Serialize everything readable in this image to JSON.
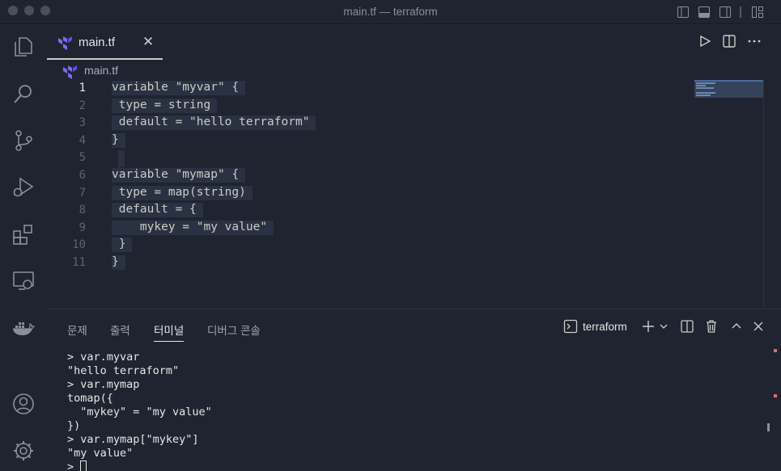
{
  "window": {
    "title": "main.tf — terraform"
  },
  "activity_bar": {
    "items": [
      "explorer-icon",
      "search-icon",
      "source-control-icon",
      "run-debug-icon",
      "extensions-icon",
      "remote-explorer-icon",
      "docker-icon",
      "account-icon",
      "settings-gear-icon"
    ]
  },
  "editor": {
    "tab": {
      "label": "main.tf",
      "close": "✕"
    },
    "breadcrumb": {
      "file": "main.tf"
    },
    "lines": [
      {
        "n": "1",
        "text": "variable \"myvar\" {"
      },
      {
        "n": "2",
        "text": " type = string"
      },
      {
        "n": "3",
        "text": " default = \"hello terraform\""
      },
      {
        "n": "4",
        "text": "}"
      },
      {
        "n": "5",
        "text": ""
      },
      {
        "n": "6",
        "text": "variable \"mymap\" {"
      },
      {
        "n": "7",
        "text": " type = map(string)"
      },
      {
        "n": "8",
        "text": " default = {"
      },
      {
        "n": "9",
        "text": "    mykey = \"my value\""
      },
      {
        "n": "10",
        "text": " }"
      },
      {
        "n": "11",
        "text": "}"
      }
    ]
  },
  "panel": {
    "tabs": [
      "문제",
      "출력",
      "터미널",
      "디버그 콘솔"
    ],
    "active_tab": "터미널",
    "terminal_name": "terraform",
    "terminal_output": [
      "> var.myvar",
      "\"hello terraform\"",
      "> var.mymap",
      "tomap({",
      "  \"mykey\" = \"my value\"",
      "})",
      "> var.mymap[\"mykey\"]",
      "\"my value\"",
      "> "
    ]
  },
  "colors": {
    "background": "#1f2430",
    "foreground": "#cbccc6",
    "selection": "#2a3142",
    "terraform_purple": "#7b6cf0"
  }
}
